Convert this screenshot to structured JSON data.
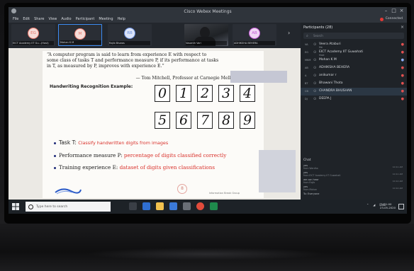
{
  "window": {
    "title": "Cisco Webex Meetings",
    "menu": [
      "File",
      "Edit",
      "Share",
      "View",
      "Audio",
      "Participant",
      "Meeting",
      "Help"
    ],
    "status": "Connected"
  },
  "video_strip": {
    "tiles": [
      {
        "initials": "EG",
        "name": "EICT Academy IIT Gu...(Host)",
        "color": "#e8776b"
      },
      {
        "initials": "M",
        "name": "Mohan K M",
        "color": "#e8776b"
      },
      {
        "initials": "RB",
        "name": "Rajib Biswas",
        "color": "#6a8fe0"
      },
      {
        "initials": "",
        "name": "Vasanth Vari",
        "color": ""
      },
      {
        "initials": "AB",
        "name": "ADHIKSHA BEHERA",
        "color": "#c45bd6"
      }
    ],
    "next_icon": "chevron-right-icon"
  },
  "slide": {
    "quote_line1": "“A computer program is said to learn from experience E with respect to",
    "quote_line2": "some class of tasks T and performance measure P, if its performance at tasks",
    "quote_line3": "in T, as measured by P, improves with experience E.”",
    "attribution": "— Tom Mitchell, Professor at Carnegie Mellon University",
    "handwriting_title": "Handwriting Recognition Example:",
    "digits_row1": [
      "0",
      "1",
      "2",
      "3",
      "4"
    ],
    "digits_row2": [
      "5",
      "6",
      "7",
      "8",
      "9"
    ],
    "bullet1_label": "Task T: ",
    "bullet1_value": "Classify handwritten digits from images",
    "bullet2_label": "Performance measure P: ",
    "bullet2_value": "percentage of digits classified correctly",
    "bullet3_label": "Training experience E: ",
    "bullet3_value": "dataset of digits given classifications",
    "page_marker": "8",
    "footer": "Information Break Group"
  },
  "participants": {
    "header": "Participants (28)",
    "search_placeholder": "Search",
    "list": [
      {
        "av": "VA",
        "name": "Veera Ataburi",
        "role": "Me",
        "mic": "red",
        "sel": false
      },
      {
        "av": "EG",
        "name": "EICT Academy IIT Guwahati",
        "role": "Host",
        "mic": "red",
        "sel": false
      },
      {
        "av": "MKM",
        "name": "Mohan K M",
        "role": "",
        "mic": "blue",
        "sel": false
      },
      {
        "av": "AB",
        "name": "ADHIKSHA BEHERA",
        "role": "",
        "mic": "red",
        "sel": false
      },
      {
        "av": "A",
        "name": "anikumar r",
        "role": "",
        "mic": "red",
        "sel": false
      },
      {
        "av": "BT",
        "name": "Bhawani Thota",
        "role": "",
        "mic": "red",
        "sel": false
      },
      {
        "av": "CB",
        "name": "CHANDRA BHUSHAN",
        "role": "",
        "mic": "red",
        "sel": true
      },
      {
        "av": "DJ",
        "name": "DEEPA J",
        "role": "",
        "mic": "red",
        "sel": false
      }
    ]
  },
  "chat": {
    "header": "Chat",
    "messages": [
      {
        "from": "yes",
        "text": "from Wardha",
        "time": "10:11 AM"
      },
      {
        "from": "yes",
        "text": "from EICT Academy IIT Guwahati",
        "time": "10:11 AM"
      },
      {
        "from": "we can hear",
        "text": "from Rajib",
        "time": "10:12 AM"
      },
      {
        "from": "yes",
        "text": "from Mohan",
        "time": "10:12 AM"
      }
    ],
    "to_label": "To:",
    "to_value": "Everyone"
  },
  "taskbar": {
    "search_placeholder": "Type here to search",
    "tray_lang": "ENG",
    "time": "21:00",
    "date": "23-05-2020"
  }
}
